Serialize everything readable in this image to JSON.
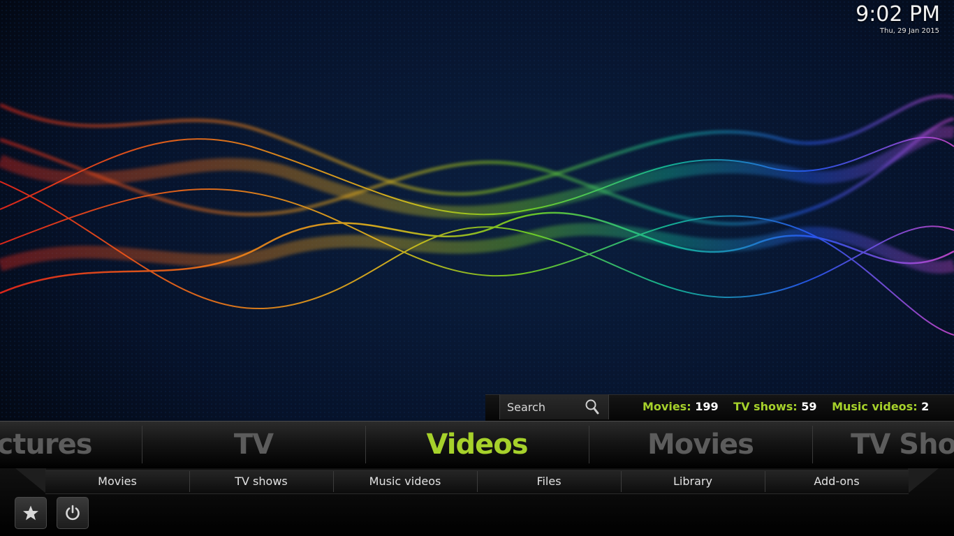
{
  "clock": {
    "time": "9:02 PM",
    "date": "Thu, 29 Jan 2015"
  },
  "search": {
    "label": "Search",
    "icon": "search-icon"
  },
  "stats": [
    {
      "label": "Movies:",
      "value": "199"
    },
    {
      "label": "TV shows:",
      "value": "59"
    },
    {
      "label": "Music videos:",
      "value": "2"
    }
  ],
  "main_menu": {
    "items": [
      "Pictures",
      "TV",
      "Videos",
      "Movies",
      "TV Shows"
    ],
    "selected": "Videos"
  },
  "sub_menu": {
    "items": [
      "Movies",
      "TV shows",
      "Music videos",
      "Files",
      "Library",
      "Add-ons"
    ]
  },
  "buttons": {
    "favourites": "star-icon",
    "power": "power-icon"
  },
  "colors": {
    "accent": "#a6d12b",
    "inactive_menu": "#5c5c5c",
    "background": "#03060d"
  }
}
